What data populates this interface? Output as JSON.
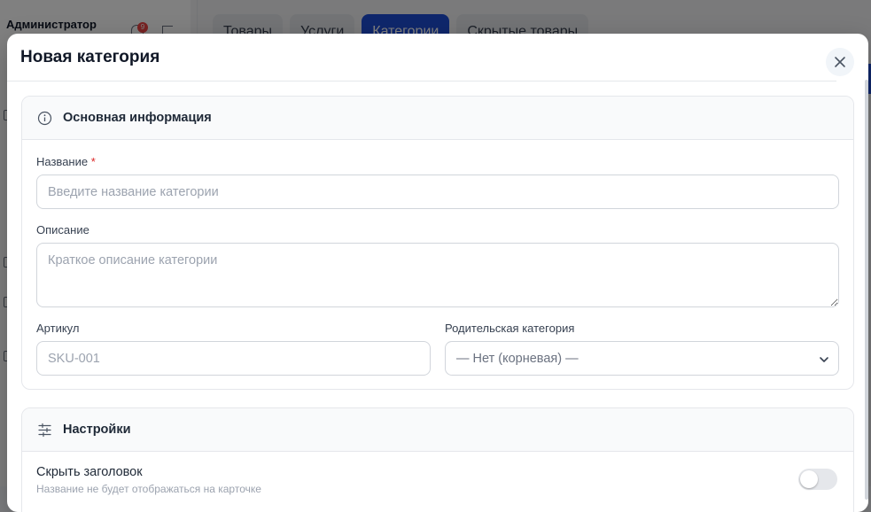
{
  "background": {
    "user_name": "Администратор",
    "notification_count": "9",
    "tabs": [
      {
        "label": "Товары"
      },
      {
        "label": "Услуги"
      },
      {
        "label": "Категории"
      },
      {
        "label": "Скрытые товары"
      }
    ],
    "active_tab": "Категории"
  },
  "modal": {
    "title": "Новая категория",
    "close_icon": "close-icon"
  },
  "basic_info": {
    "title": "Основная информация",
    "icon": "info-icon",
    "name_label": "Название",
    "required_mark": "*",
    "name_placeholder": "Введите название категории",
    "name_value": "",
    "description_label": "Описание",
    "description_placeholder": "Краткое описание категории",
    "description_value": "",
    "sku_label": "Артикул",
    "sku_placeholder": "SKU-001",
    "sku_value": "",
    "parent_label": "Родительская категория",
    "parent_selected": "— Нет (корневая) —"
  },
  "settings": {
    "title": "Настройки",
    "icon": "sliders-icon",
    "hide_title_label": "Скрыть заголовок",
    "hide_title_hint": "Название не будет отображаться на карточке",
    "hide_title_enabled": false
  },
  "colors": {
    "accent": "#1d4ed8",
    "required": "#dc2626"
  }
}
